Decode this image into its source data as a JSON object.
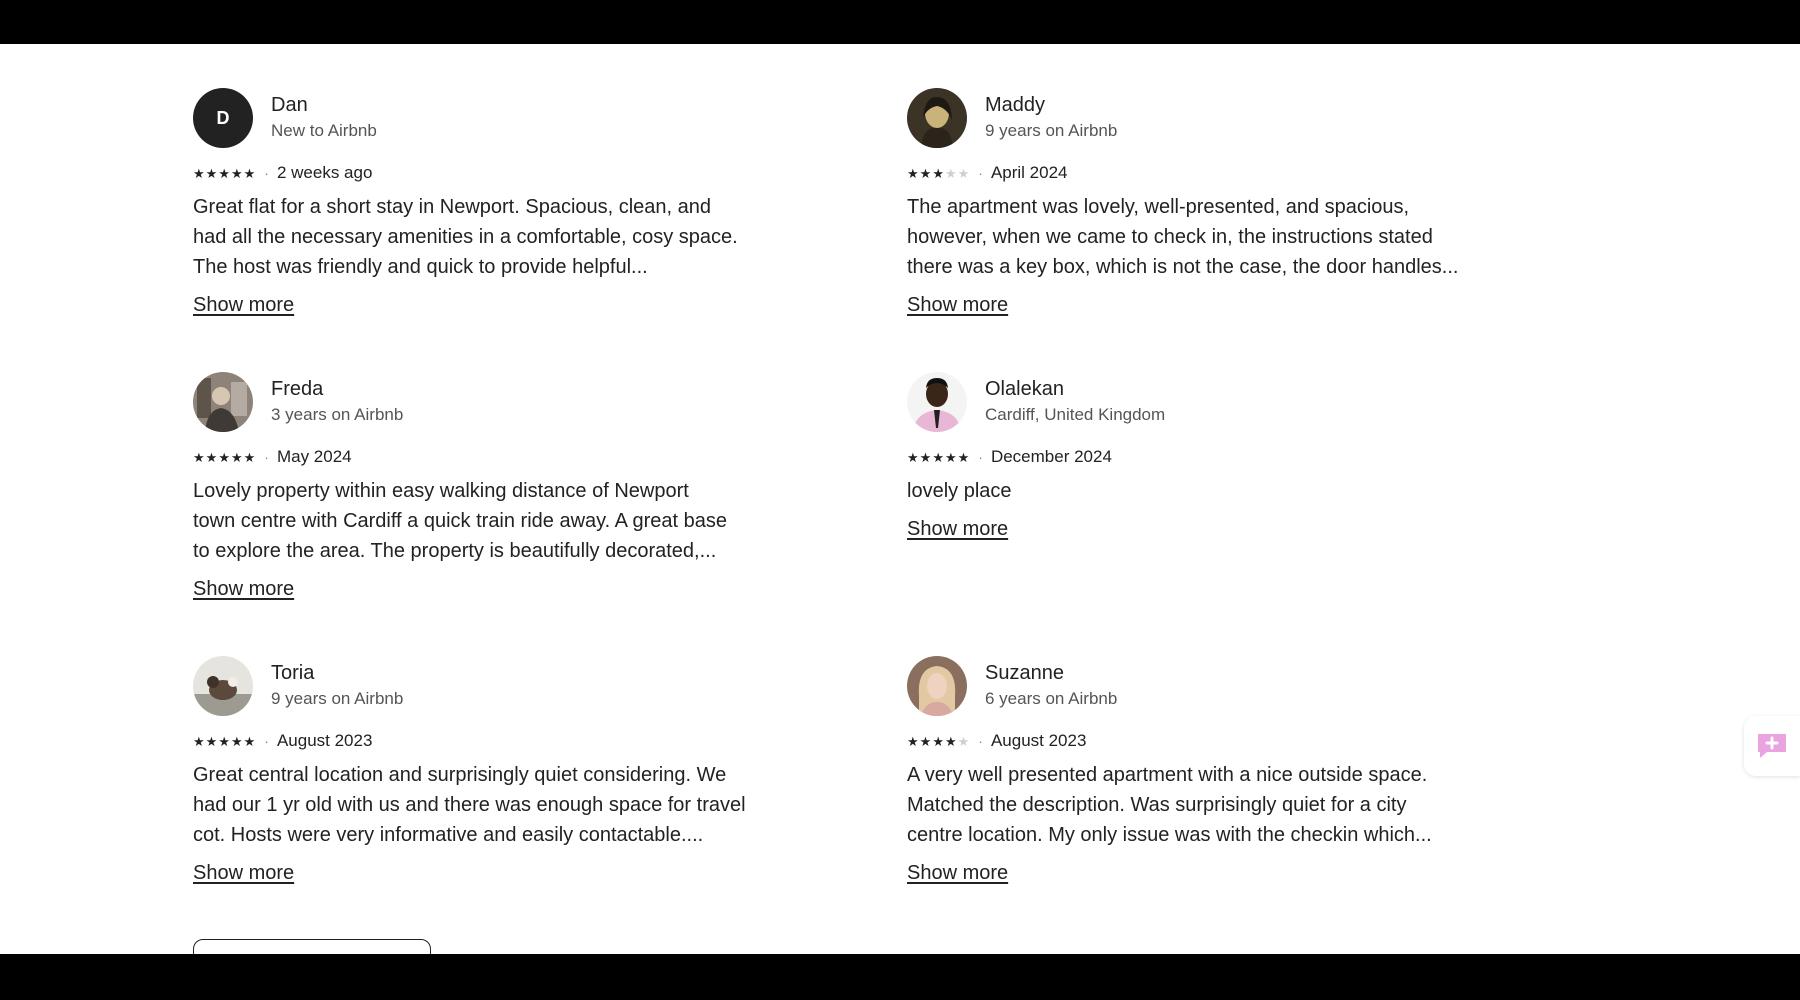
{
  "reviews": [
    {
      "name": "Dan",
      "initial": "D",
      "subtitle": "New to Airbnb",
      "rating": 5,
      "date": "2 weeks ago",
      "lines": [
        "Great flat for a short stay in Newport. Spacious, clean, and",
        "had all the necessary amenities in a comfortable, cosy space.",
        "The host was friendly and quick to provide helpful..."
      ],
      "more_label": "Show more"
    },
    {
      "name": "Maddy",
      "subtitle": "9 years on Airbnb",
      "rating": 3,
      "date": "April 2024",
      "lines": [
        "The apartment was lovely, well-presented, and spacious,",
        "however, when we came to check in, the instructions stated",
        "there was a key box, which is not the case, the door handles..."
      ],
      "more_label": "Show more"
    },
    {
      "name": "Freda",
      "subtitle": "3 years on Airbnb",
      "rating": 5,
      "date": "May 2024",
      "lines": [
        "Lovely property within easy walking distance of Newport",
        "town centre with Cardiff a quick train ride away. A great base",
        "to explore the area. The property is beautifully decorated,..."
      ],
      "more_label": "Show more"
    },
    {
      "name": "Olalekan",
      "subtitle": "Cardiff, United Kingdom",
      "rating": 5,
      "date": "December 2024",
      "lines": [
        "lovely place"
      ],
      "more_label": "Show more"
    },
    {
      "name": "Toria",
      "subtitle": "9 years on Airbnb",
      "rating": 5,
      "date": "August 2023",
      "lines": [
        "Great central location and surprisingly quiet considering. We",
        "had our 1 yr old with us and there was enough space for travel",
        "cot. Hosts were very informative and easily contactable...."
      ],
      "more_label": "Show more"
    },
    {
      "name": "Suzanne",
      "subtitle": "6 years on Airbnb",
      "rating": 4,
      "date": "August 2023",
      "lines": [
        "A very well presented apartment with a nice outside space.",
        "Matched the description. Was surprisingly quiet for a city",
        "centre location. My only issue was with the checkin which..."
      ],
      "more_label": "Show more"
    }
  ],
  "colors": {
    "text": "#222222",
    "subtext": "#555555",
    "star_off": "#cfcfcf",
    "feedback_accent": "#e8a3e0"
  }
}
